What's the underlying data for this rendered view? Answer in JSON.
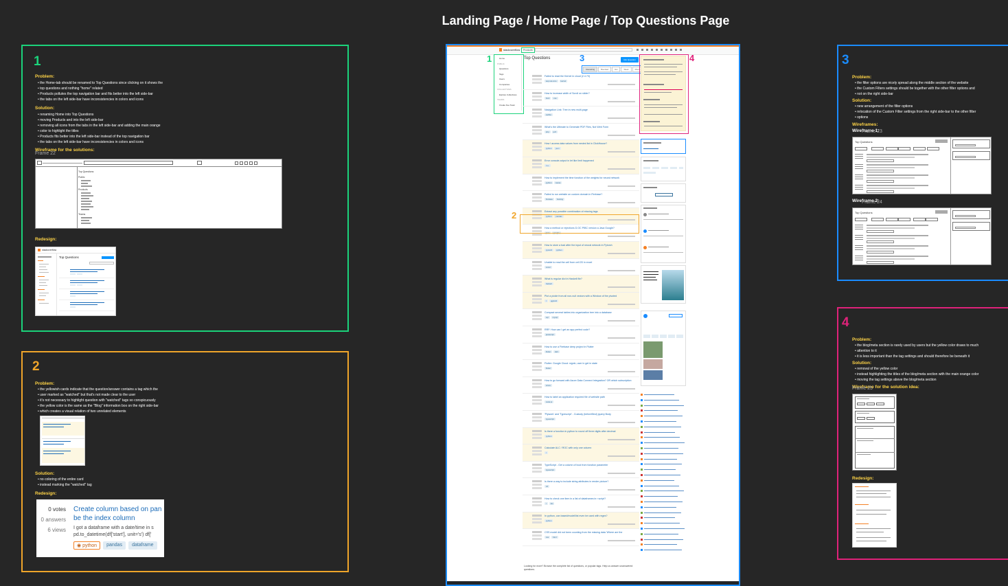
{
  "title": "Landing Page / Home Page / Top Questions Page",
  "colors": {
    "green": "#1bd37b",
    "orange": "#f0a52a",
    "blue": "#1a8cff",
    "pink": "#e0227a",
    "yellow": "#ffd447"
  },
  "frame1": {
    "number": "1",
    "problem_label": "Problem:",
    "problems": [
      "the Home-tab should be renamed to Top Questions since clicking on it shows the",
      "top questions and nothing \"home\" related",
      "Products pollutes the top navigation bar and fits better into the left side-bar",
      "the tabs on the left side-bar have inconsistencies in colors and icons"
    ],
    "solution_label": "Solution:",
    "solutions": [
      "renaming Home into Top Questions",
      "moving Products and into the left side-bar",
      "removing all icons from the tabs in the left side-bar and adding the main orange",
      "color to highlight the titles",
      "Products fits better into the left side-bar instead of the top navigation bar",
      "the tabs on the left side-bar have inconsistencies in colors and icons"
    ],
    "wireframe_label": "Wireframe for the solutions:",
    "wireframe_caption": "Frame 22",
    "wf_side_items": [
      "Top Questions",
      "Public",
      "Products",
      "Teams"
    ],
    "redesign_label": "Redesign:",
    "mini_title": "Top Questions"
  },
  "frame2": {
    "number": "2",
    "problem_label": "Problem:",
    "problems": [
      "the yellowish cards indicate that the question/answer contains a tag which the",
      "user marked as \"watched\" but that's not made clear to the user",
      "it's not necessary to highlight question with \"watched\" tags so conspicuously",
      "the yellow color is the same as the \"Blog\" information box on the right side-bar",
      "which creates a visual relation of two unrelated elements"
    ],
    "solution_label": "Solution:",
    "solutions": [
      "no coloring of the entire card",
      "instead marking the \"watched\" tag"
    ],
    "redesign_label": "Redesign:",
    "card": {
      "votes": "0 votes",
      "answers": "0 answers",
      "views": "6 views",
      "title_line1": "Create column based on pan",
      "title_line2": "be the index column",
      "excerpt_line1": "I got a dataframe with a date/time in s",
      "excerpt_line2": "pd.to_datetime(df['start'], unit='s') df['",
      "tags": [
        "python",
        "pandas",
        "dataframe"
      ]
    }
  },
  "frame3": {
    "number": "3",
    "problem_label": "Problem:",
    "problems": [
      "the filter options are nicely spread along the middle section of the website",
      "the Custom Filters settings should be together with the other filter options and",
      "not on the right side-bar"
    ],
    "solution_label": "Solution:",
    "solutions": [
      "new arrangement of the filter options",
      "relocation of the Custom Filter settings from the right side-bar to the other filter",
      "options"
    ],
    "wireframes_label": "Wireframes:",
    "wf1_label": "Wireframe 1:",
    "wf1_caption": "Frame 23",
    "wf2_label": "Wireframe 2:",
    "wf2_caption": "Frame 24",
    "wf_title": "Top Questions"
  },
  "frame4": {
    "number": "4",
    "problem_label": "Problem:",
    "problems": [
      "the blog/meta section is rarely used by users but the yellow color draws to much",
      "attention to it",
      "it is less important than the tag settings and should therefore be beneath it"
    ],
    "solution_label": "Solution:",
    "solutions": [
      "removal of the yellow color",
      "instead highlighting the titles of the blog/meta section with the main orange color",
      "moving the tag settings above the blog/meta section"
    ],
    "wireframe_label": "Wireframe for the solution idea:",
    "wireframe_caption": "Frame 25",
    "redesign_label": "Redesign:"
  },
  "center": {
    "logo": "stackoverflow",
    "products": "Products",
    "heading": "Top Questions",
    "ask_button": "Ask Question",
    "filters": [
      "Interesting",
      "Bountied",
      "Hot",
      "Week",
      "Month"
    ],
    "footer": "Looking for more? Browse the complete list of questions, or popular tags. Help us answer unanswered questions.",
    "callouts": [
      "1",
      "3",
      "4",
      "2"
    ],
    "side_nav": [
      "Home",
      "PUBLIC",
      "Questions",
      "Tags",
      "Users",
      "Companies",
      "COLLECTIVES",
      "Explore Collectives",
      "TEAMS",
      "Create free Team"
    ],
    "questions": [
      {
        "t": "Failed to read the Kernel in cloud (2.4.73)",
        "tags": [
          "asp.net-core",
          "kernel"
        ],
        "y": false
      },
      {
        "t": "How to increase width of Scroll on slider?",
        "tags": [
          "html",
          "css"
        ],
        "y": false
      },
      {
        "t": "Navigation Link: Tree in new multi-page",
        "tags": [
          "swiftui"
        ],
        "y": false
      },
      {
        "t": "What's the Ultimate to Generate PDF Files, Not Web Form",
        "tags": [
          "php",
          "pdf"
        ],
        "y": false
      },
      {
        "t": "How I access data values from nested list in ClickHouse?",
        "tags": [
          "python",
          "json"
        ],
        "y": true
      },
      {
        "t": "Error console.output in let like limit happened",
        "tags": [
          "c++"
        ],
        "y": true
      },
      {
        "t": "How to implement the time function of the weights for neural network",
        "tags": [
          "python",
          "keras"
        ],
        "y": false
      },
      {
        "t": "Failed to run website on custom domain in Firebase?",
        "tags": [
          "firebase",
          "hosting"
        ],
        "y": false
      },
      {
        "t": "Extract any possible combination of missing tags",
        "tags": [
          "python",
          "pandas"
        ],
        "y": true
      },
      {
        "t": "How a method or rejections D.OC PIBC version a Java Google?",
        "tags": [
          "java",
          "google"
        ],
        "y": false
      },
      {
        "t": "How to store a bad after the input of neural network in Pytorch",
        "tags": [
          "pytorch",
          "python"
        ],
        "y": true
      },
      {
        "t": "Unable to read the cell from cell 2D in excel",
        "tags": [
          "excel"
        ],
        "y": false
      },
      {
        "t": "What is regular dict in Haskell file?",
        "tags": [
          "haskell"
        ],
        "y": true
      },
      {
        "t": "Plot a pickle from all non-null vectors with a Window of the pivoted",
        "tags": [
          "r",
          "ggplot2"
        ],
        "y": true
      },
      {
        "t": "Compact several tables into organization tree into a database",
        "tags": [
          "sql",
          "mysql"
        ],
        "y": false
      },
      {
        "t": "RRF: How can I get an app perfect code?",
        "tags": [
          "javascript"
        ],
        "y": false
      },
      {
        "t": "How to use a Firebase deep project in Flutter",
        "tags": [
          "flutter",
          "dart"
        ],
        "y": false
      },
      {
        "t": "Flutter: Google Cloud: signin, user in get in state",
        "tags": [
          "flutter"
        ],
        "y": false
      },
      {
        "t": "How to go forward with Azure Data Connect Integration? OR which subscription",
        "tags": [
          "azure"
        ],
        "y": false
      },
      {
        "t": "How to label an application required file of website path",
        "tags": [
          "node.js"
        ],
        "y": false
      },
      {
        "t": "'Plywork' and 'Typescript' - Custody (beforeBind) jquery Body",
        "tags": [
          "typescript"
        ],
        "y": false
      },
      {
        "t": "Is there a function in python to round off three digits after decimal",
        "tags": [
          "python"
        ],
        "y": true
      },
      {
        "t": "Calculate ALC / ROC with only one column",
        "tags": [
          "r"
        ],
        "y": true
      },
      {
        "t": "TypeScript - Get a column of bool from function parameter",
        "tags": [
          "typescript"
        ],
        "y": false
      },
      {
        "t": "Is there a way to include string attributes in render picture?",
        "tags": [
          "c#"
        ],
        "y": false
      },
      {
        "t": "How to check one item in a list of dataframes in r script?",
        "tags": [
          "r",
          "list"
        ],
        "y": false
      },
      {
        "t": "In python, can based/model/list even be used with regex?",
        "tags": [
          "python"
        ],
        "y": true
      },
      {
        "t": "CSS model did not been counting from the missing data 'Where are the",
        "tags": [
          "css",
          "html"
        ],
        "y": false
      }
    ]
  }
}
